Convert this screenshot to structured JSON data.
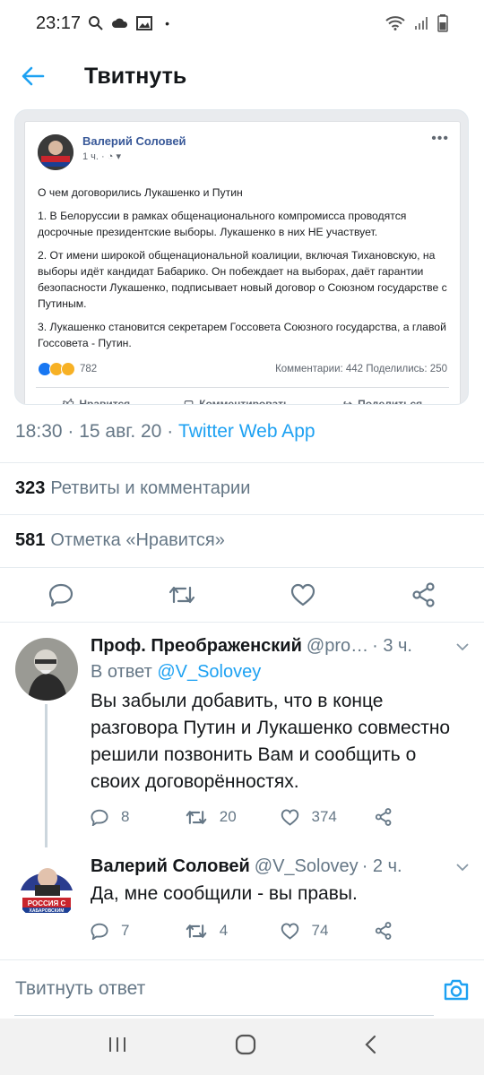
{
  "status_bar": {
    "time": "23:17"
  },
  "header": {
    "title": "Твитнуть"
  },
  "embed": {
    "author": "Валерий Соловей",
    "meta": "1 ч. ·",
    "avatar_text_line1": "РОССИЯ С",
    "avatar_text_line2": "ХАБАРОВСКИМ",
    "paragraphs": [
      "О чем договорились Лукашенко и Путин",
      "1. В Белоруссии в рамках общенационального компромисса проводятся досрочные президентские выборы. Лукашенко в них НЕ участвует.",
      "2. От имени широкой общенациональной коалиции, включая Тихановскую, на выборы идёт кандидат Бабарико. Он побеждает на выборах, даёт гарантии безопасности Лукашенко, подписывает новый договор о Союзном государстве с Путиным.",
      "3. Лукашенко становится секретарем Госсовета Союзного государства, а главой Госсовета - Путин."
    ],
    "reaction_count": "782",
    "stats": "Комментарии: 442  Поделились: 250",
    "actions": [
      "Нравится",
      "Комментировать",
      "Поделиться"
    ]
  },
  "tweet": {
    "time": "18:30 · 15 авг. 20 · ",
    "app": "Twitter Web App",
    "retweets_count": "323",
    "retweets_label": "Ретвиты и комментарии",
    "likes_count": "581",
    "likes_label": "Отметка «Нравится»"
  },
  "replies": [
    {
      "name": "Проф. Преображенский",
      "handle": "@pro…",
      "time": "· 3 ч.",
      "in_reply_prefix": "В ответ ",
      "in_reply_mention": "@V_Solovey",
      "text": "Вы забыли добавить, что в конце разговора Путин и Лукашенко совместно решили позвонить Вам и сообщить о своих договорённостях.",
      "replies": "8",
      "retweets": "20",
      "likes": "374"
    },
    {
      "name": "Валерий Соловей",
      "handle": "@V_Solovey",
      "time": "· 2 ч.",
      "text": "Да, мне сообщили - вы правы.",
      "replies": "7",
      "retweets": "4",
      "likes": "74",
      "avatar_text_line1": "РОССИЯ С",
      "avatar_text_line2": "ХАБАРОВСКИМ"
    }
  ],
  "compose": {
    "placeholder": "Твитнуть ответ"
  },
  "colors": {
    "accent": "#1da1f2",
    "text": "#14171a",
    "secondary": "#657786",
    "fb_blue": "#385898"
  },
  "icons": [
    "back-arrow-icon",
    "reply-icon",
    "retweet-icon",
    "like-icon",
    "share-icon",
    "camera-icon",
    "chevron-down-icon"
  ]
}
